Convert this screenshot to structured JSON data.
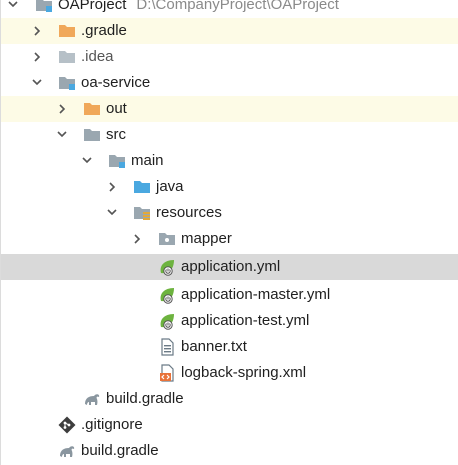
{
  "project_root": {
    "name": "OAProject",
    "path": "D:\\CompanyProject\\OAProject"
  },
  "nodes": [
    {
      "label": ".gradle"
    },
    {
      "label": ".idea"
    },
    {
      "label": "oa-service"
    },
    {
      "label": "out"
    },
    {
      "label": "src"
    },
    {
      "label": "main"
    },
    {
      "label": "java"
    },
    {
      "label": "resources"
    },
    {
      "label": "mapper"
    },
    {
      "label": "application.yml"
    },
    {
      "label": "application-master.yml"
    },
    {
      "label": "application-test.yml"
    },
    {
      "label": "banner.txt"
    },
    {
      "label": "logback-spring.xml"
    },
    {
      "label": "build.gradle"
    },
    {
      "label": ".gitignore"
    },
    {
      "label": "build.gradle"
    }
  ],
  "colors": {
    "excluded_folder": "#f0a85a",
    "folder": "#9aa7b0",
    "source_folder": "#4aa8e0",
    "spring": "#6db33f",
    "selected_row": "#d9d9d9",
    "highlight_row": "#fdfbe6"
  }
}
